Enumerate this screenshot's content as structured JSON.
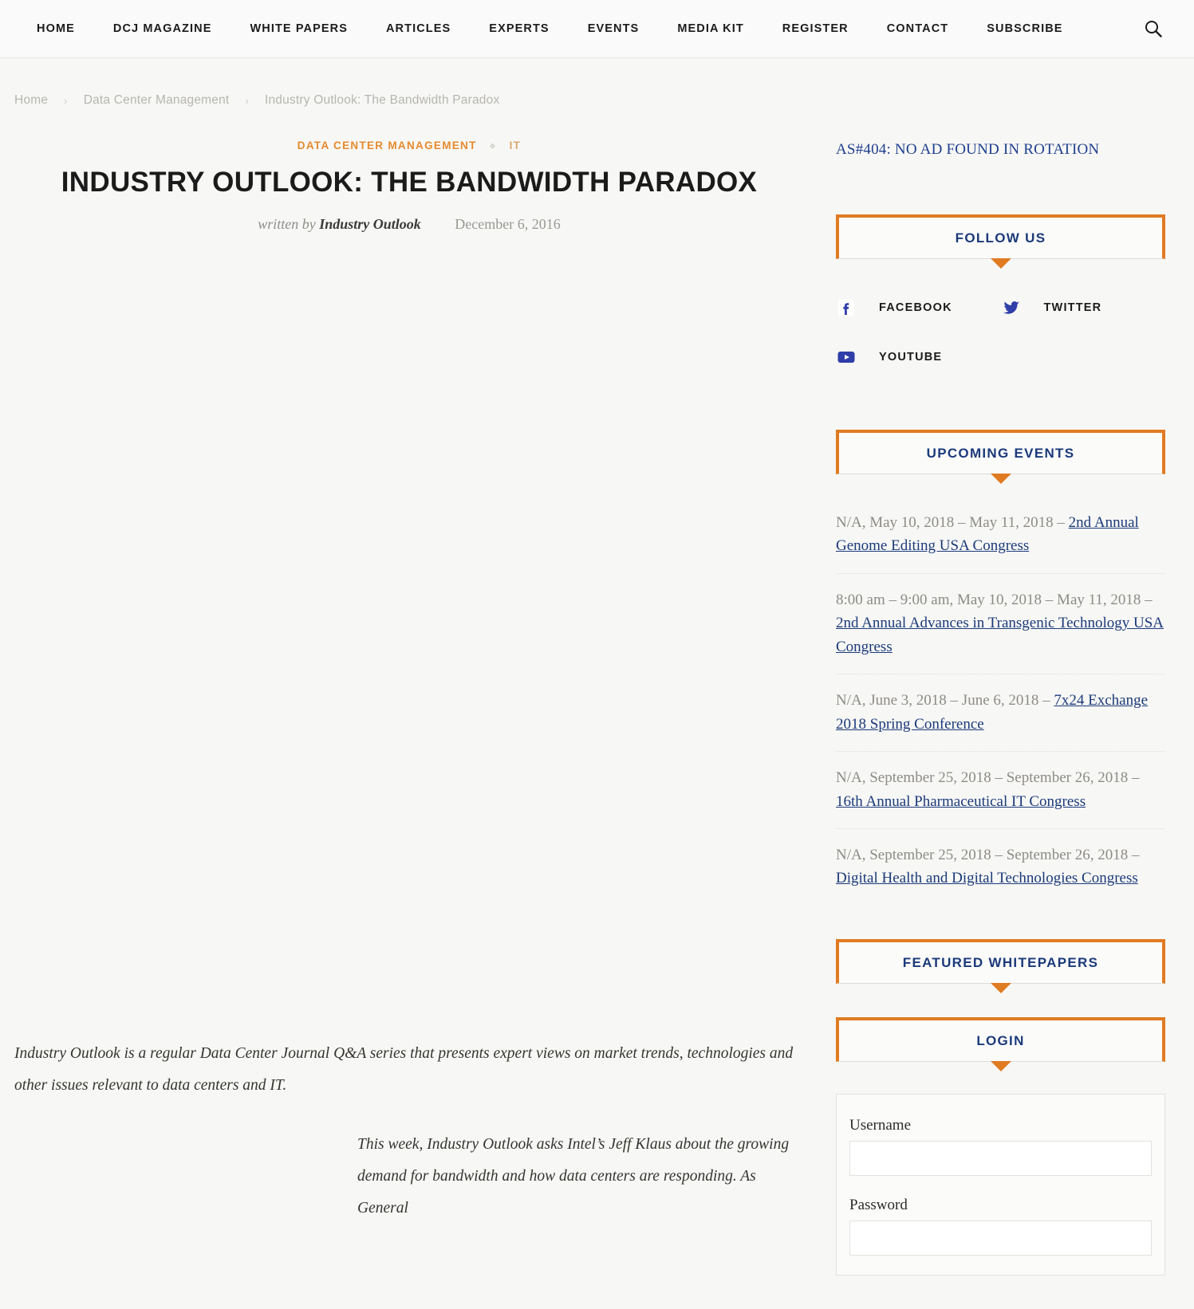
{
  "nav": {
    "items": [
      {
        "label": "HOME"
      },
      {
        "label": "DCJ MAGAZINE"
      },
      {
        "label": "WHITE PAPERS"
      },
      {
        "label": "ARTICLES"
      },
      {
        "label": "EXPERTS"
      },
      {
        "label": "EVENTS"
      },
      {
        "label": "MEDIA KIT"
      },
      {
        "label": "REGISTER"
      },
      {
        "label": "CONTACT"
      },
      {
        "label": "SUBSCRIBE"
      }
    ],
    "search_icon": "search-icon"
  },
  "breadcrumb": {
    "home": "Home",
    "section": "Data Center Management",
    "current": "Industry Outlook: The Bandwidth Paradox",
    "separator": "›"
  },
  "article": {
    "categories": [
      {
        "label": "DATA CENTER MANAGEMENT"
      },
      {
        "label": "IT"
      }
    ],
    "category_separator": "⋄",
    "title": "INDUSTRY OUTLOOK: THE BANDWIDTH PARADOX",
    "written_by_label": "written by",
    "author": "Industry Outlook",
    "date": "December 6, 2016",
    "paragraphs": [
      "Industry Outlook is a regular Data Center Journal Q&A series that presents expert views on market trends, technologies and other issues relevant to data centers and IT.",
      "This week, Industry Outlook asks Intel’s Jeff Klaus about the growing demand for bandwidth and how data centers are responding. As General"
    ]
  },
  "sidebar": {
    "ad": {
      "text": "AS#404: NO AD FOUND IN ROTATION"
    },
    "follow": {
      "title": "FOLLOW US",
      "items": [
        {
          "label": "FACEBOOK",
          "icon": "facebook-icon"
        },
        {
          "label": "TWITTER",
          "icon": "twitter-icon"
        },
        {
          "label": "YOUTUBE",
          "icon": "youtube-icon"
        }
      ]
    },
    "events": {
      "title": "UPCOMING EVENTS",
      "items": [
        {
          "when": "N/A, May 10, 2018 – May 11, 2018 – ",
          "name": "2nd Annual Genome Editing USA Congress"
        },
        {
          "when": "8:00 am – 9:00 am, May 10, 2018 – May 11, 2018 – ",
          "name": "2nd Annual Advances in Transgenic Technology USA Congress"
        },
        {
          "when": "N/A, June 3, 2018 – June 6, 2018 – ",
          "name": "7x24 Exchange 2018 Spring Conference"
        },
        {
          "when": "N/A, September 25, 2018 – September 26, 2018 – ",
          "name": "16th Annual Pharmaceutical IT Congress"
        },
        {
          "when": "N/A, September 25, 2018 – September 26, 2018 – ",
          "name": "Digital Health and Digital Technologies Congress"
        }
      ]
    },
    "whitepapers": {
      "title": "FEATURED WHITEPAPERS"
    },
    "login": {
      "title": "LOGIN",
      "username_label": "Username",
      "username_value": "",
      "password_label": "Password",
      "password_value": ""
    }
  },
  "colors": {
    "accent_orange": "#e07b22",
    "link_blue": "#1b3a7a",
    "category_orange": "#e58a2e",
    "muted_gray": "#b6b5b1",
    "page_bg": "#f7f7f5"
  }
}
